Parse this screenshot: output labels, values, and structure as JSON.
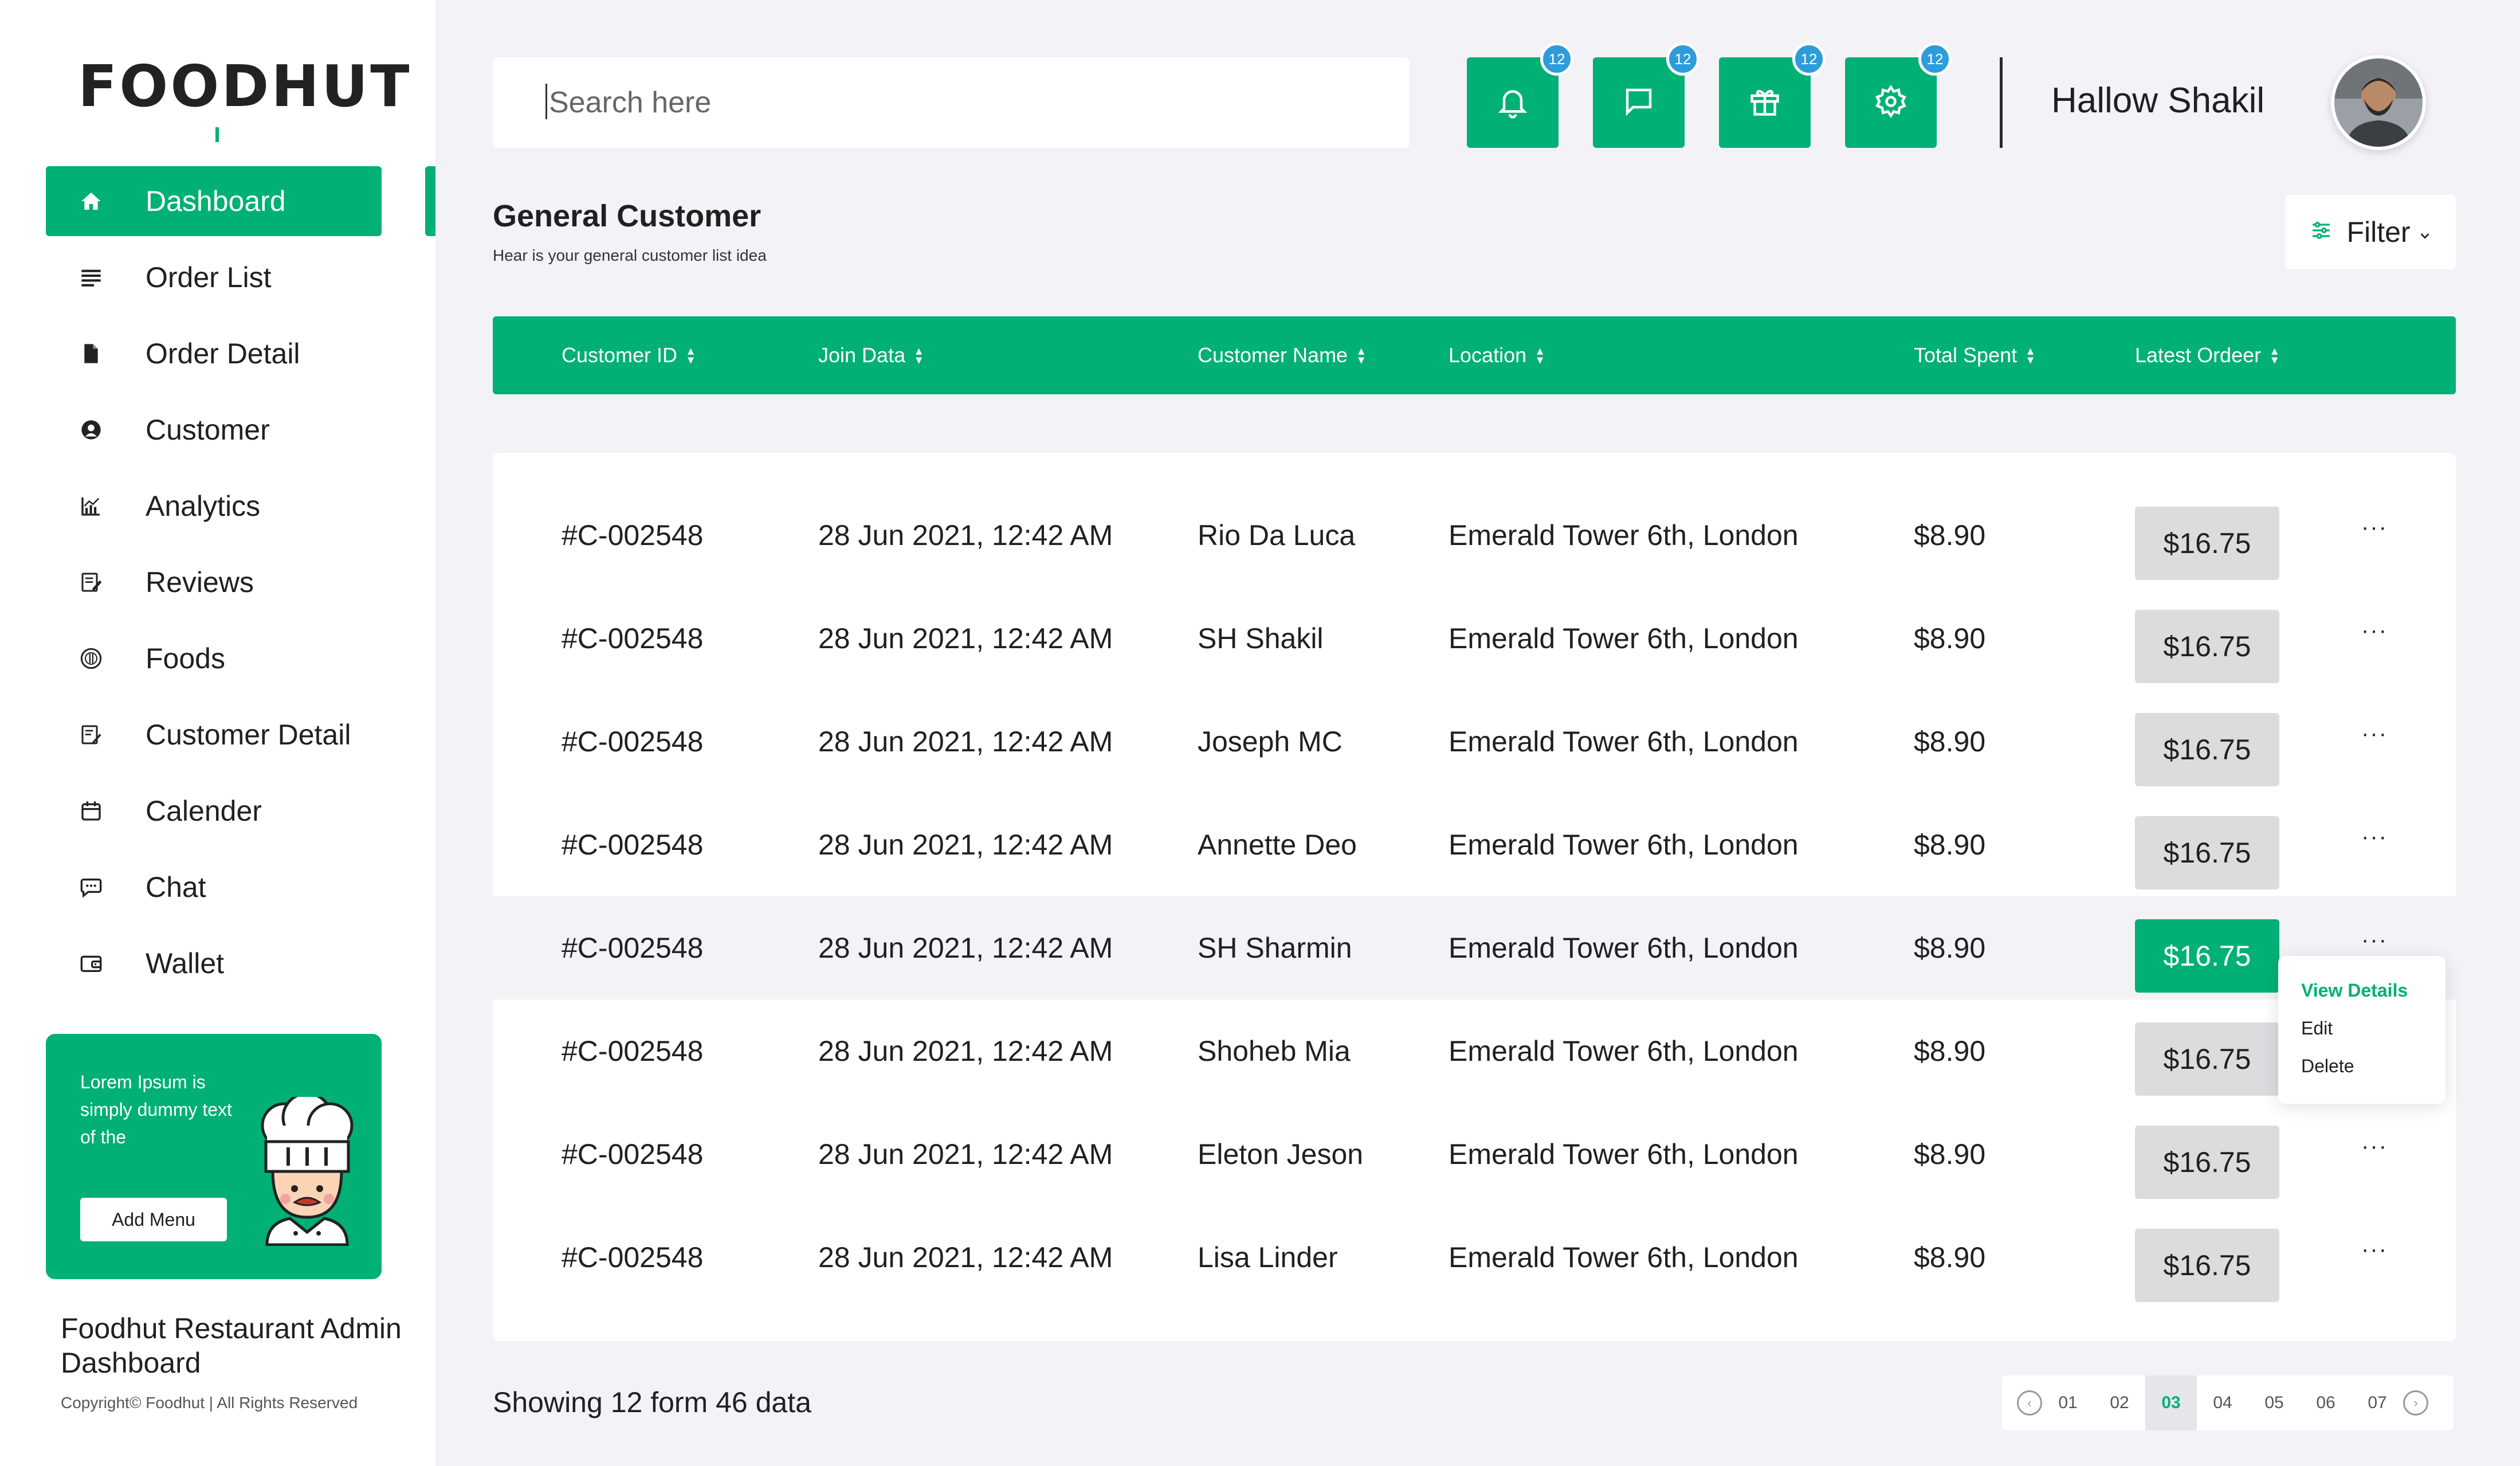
{
  "brand": {
    "logo": "FOODHUT",
    "accent": "#00b074",
    "badge_color": "#2d9cdb"
  },
  "sidebar": {
    "items": [
      {
        "label": "Dashboard",
        "icon": "home-icon",
        "active": true
      },
      {
        "label": "Order List",
        "icon": "list-icon"
      },
      {
        "label": "Order Detail",
        "icon": "document-icon"
      },
      {
        "label": "Customer",
        "icon": "user-icon"
      },
      {
        "label": "Analytics",
        "icon": "chart-icon"
      },
      {
        "label": "Reviews",
        "icon": "edit-icon"
      },
      {
        "label": "Foods",
        "icon": "food-icon"
      },
      {
        "label": "Customer Detail",
        "icon": "clipboard-icon"
      },
      {
        "label": "Calender",
        "icon": "calendar-icon"
      },
      {
        "label": "Chat",
        "icon": "chat-icon"
      },
      {
        "label": "Wallet",
        "icon": "wallet-icon"
      }
    ],
    "promo": {
      "text": "Lorem Ipsum is simply dummy text of the",
      "button": "Add Menu",
      "image": "chef-illustration"
    },
    "footer_title": "Foodhut Restaurant Admin Dashboard",
    "copyright": "Copyright© Foodhut | All Rights Reserved"
  },
  "header": {
    "search_placeholder": "Search here",
    "buttons": [
      {
        "icon": "bell-icon",
        "badge": "12"
      },
      {
        "icon": "message-icon",
        "badge": "12"
      },
      {
        "icon": "gift-icon",
        "badge": "12"
      },
      {
        "icon": "gear-icon",
        "badge": "12"
      }
    ],
    "username": "Hallow Shakil"
  },
  "page": {
    "title": "General Customer",
    "subtitle": "Hear is your general customer list idea",
    "filter_label": "Filter"
  },
  "table": {
    "columns": [
      "Customer ID",
      "Join Data",
      "Customer Name",
      "Location",
      "Total Spent",
      "Latest Ordeer"
    ],
    "rows": [
      {
        "id": "#C-002548",
        "date": "28 Jun 2021, 12:42 AM",
        "name": "Rio Da Luca",
        "location": "Emerald Tower 6th, London",
        "spent": "$8.90",
        "latest": "$16.75",
        "more": "···"
      },
      {
        "id": "#C-002548",
        "date": "28 Jun 2021, 12:42 AM",
        "name": "SH Shakil",
        "location": "Emerald Tower 6th, London",
        "spent": "$8.90",
        "latest": "$16.75",
        "more": "···"
      },
      {
        "id": "#C-002548",
        "date": "28 Jun 2021, 12:42 AM",
        "name": "Joseph  MC",
        "location": "Emerald Tower 6th, London",
        "spent": "$8.90",
        "latest": "$16.75",
        "more": "···"
      },
      {
        "id": "#C-002548",
        "date": "28 Jun 2021, 12:42 AM",
        "name": "Annette Deo",
        "location": "Emerald Tower 6th, London",
        "spent": "$8.90",
        "latest": "$16.75",
        "more": "···"
      },
      {
        "id": "#C-002548",
        "date": "28 Jun 2021, 12:42 AM",
        "name": "SH Sharmin",
        "location": "Emerald Tower 6th, London",
        "spent": "$8.90",
        "latest": "$16.75",
        "more": "···",
        "highlighted": true
      },
      {
        "id": "#C-002548",
        "date": "28 Jun 2021, 12:42 AM",
        "name": "Shoheb Mia",
        "location": "Emerald Tower 6th, London",
        "spent": "$8.90",
        "latest": "$16.75",
        "more": ""
      },
      {
        "id": "#C-002548",
        "date": "28 Jun 2021, 12:42 AM",
        "name": "Eleton  Jeson",
        "location": "Emerald Tower 6th, London",
        "spent": "$8.90",
        "latest": "$16.75",
        "more": "···"
      },
      {
        "id": "#C-002548",
        "date": "28 Jun 2021, 12:42 AM",
        "name": "Lisa Linder",
        "location": "Emerald Tower 6th, London",
        "spent": "$8.90",
        "latest": "$16.75",
        "more": "···"
      }
    ],
    "context_menu": [
      "View Details",
      "Edit",
      "Delete"
    ]
  },
  "pagination": {
    "summary": "Showing 12 form 46 data",
    "pages": [
      "01",
      "02",
      "03",
      "04",
      "05",
      "06",
      "07"
    ],
    "current": "03"
  }
}
